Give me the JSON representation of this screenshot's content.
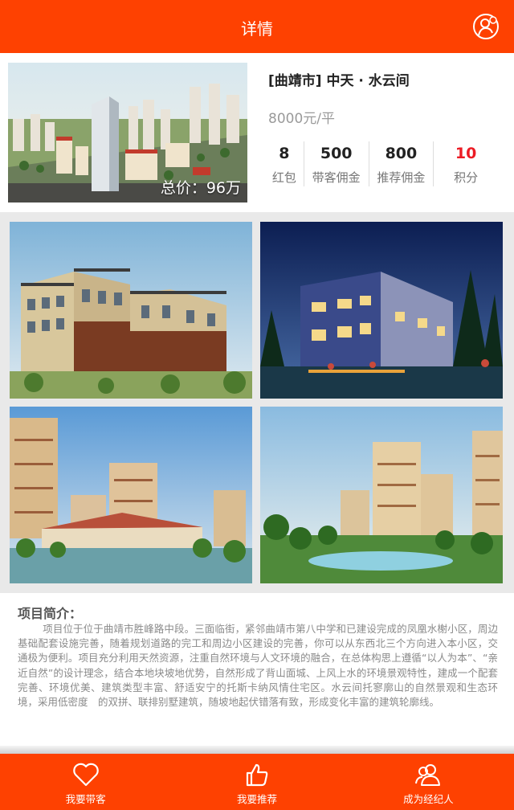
{
  "header": {
    "title": "详情"
  },
  "project": {
    "title": "[曲靖市] 中天 · 水云间",
    "unit_price": "8000元/平",
    "total_price": "总价：96万"
  },
  "stats": [
    {
      "value": "8",
      "label": "红包"
    },
    {
      "value": "500",
      "label": "带客佣金"
    },
    {
      "value": "800",
      "label": "推荐佣金"
    },
    {
      "value": "10",
      "label": "积分"
    }
  ],
  "intro": {
    "heading": "项目简介：",
    "text": "项目位于位于曲靖市胜峰路中段。三面临街，紧邻曲靖市第八中学和已建设完成的凤凰水榭小区，周边基础配套设施完善，随着规划道路的完工和周边小区建设的完善，你可以从东西北三个方向进入本小区，交通极为便利。项目充分利用天然资源，注重自然环境与人文环境的融合，在总体构思上遵循“以人为本”、“亲近自然”的设计理念，结合本地块坡地优势，自然形成了背山面城、上风上水的环境景观特性，建成一个配套完善、环境优美、建筑类型丰富、舒适安宁的托斯卡纳风情住宅区。水云间托寥廓山的自然景观和生态环境，采用低密度　的双拼、联排别墅建筑，随坡地起伏错落有致，形成变化丰富的建筑轮廓线。"
  },
  "tabbar": {
    "tabs": [
      {
        "label": "我要带客",
        "icon": "heart-icon"
      },
      {
        "label": "我要推荐",
        "icon": "thumbs-up-icon"
      },
      {
        "label": "成为经纪人",
        "icon": "users-icon"
      }
    ]
  },
  "colors": {
    "brand": "#fe4101",
    "highlight": "#ec1b24"
  }
}
